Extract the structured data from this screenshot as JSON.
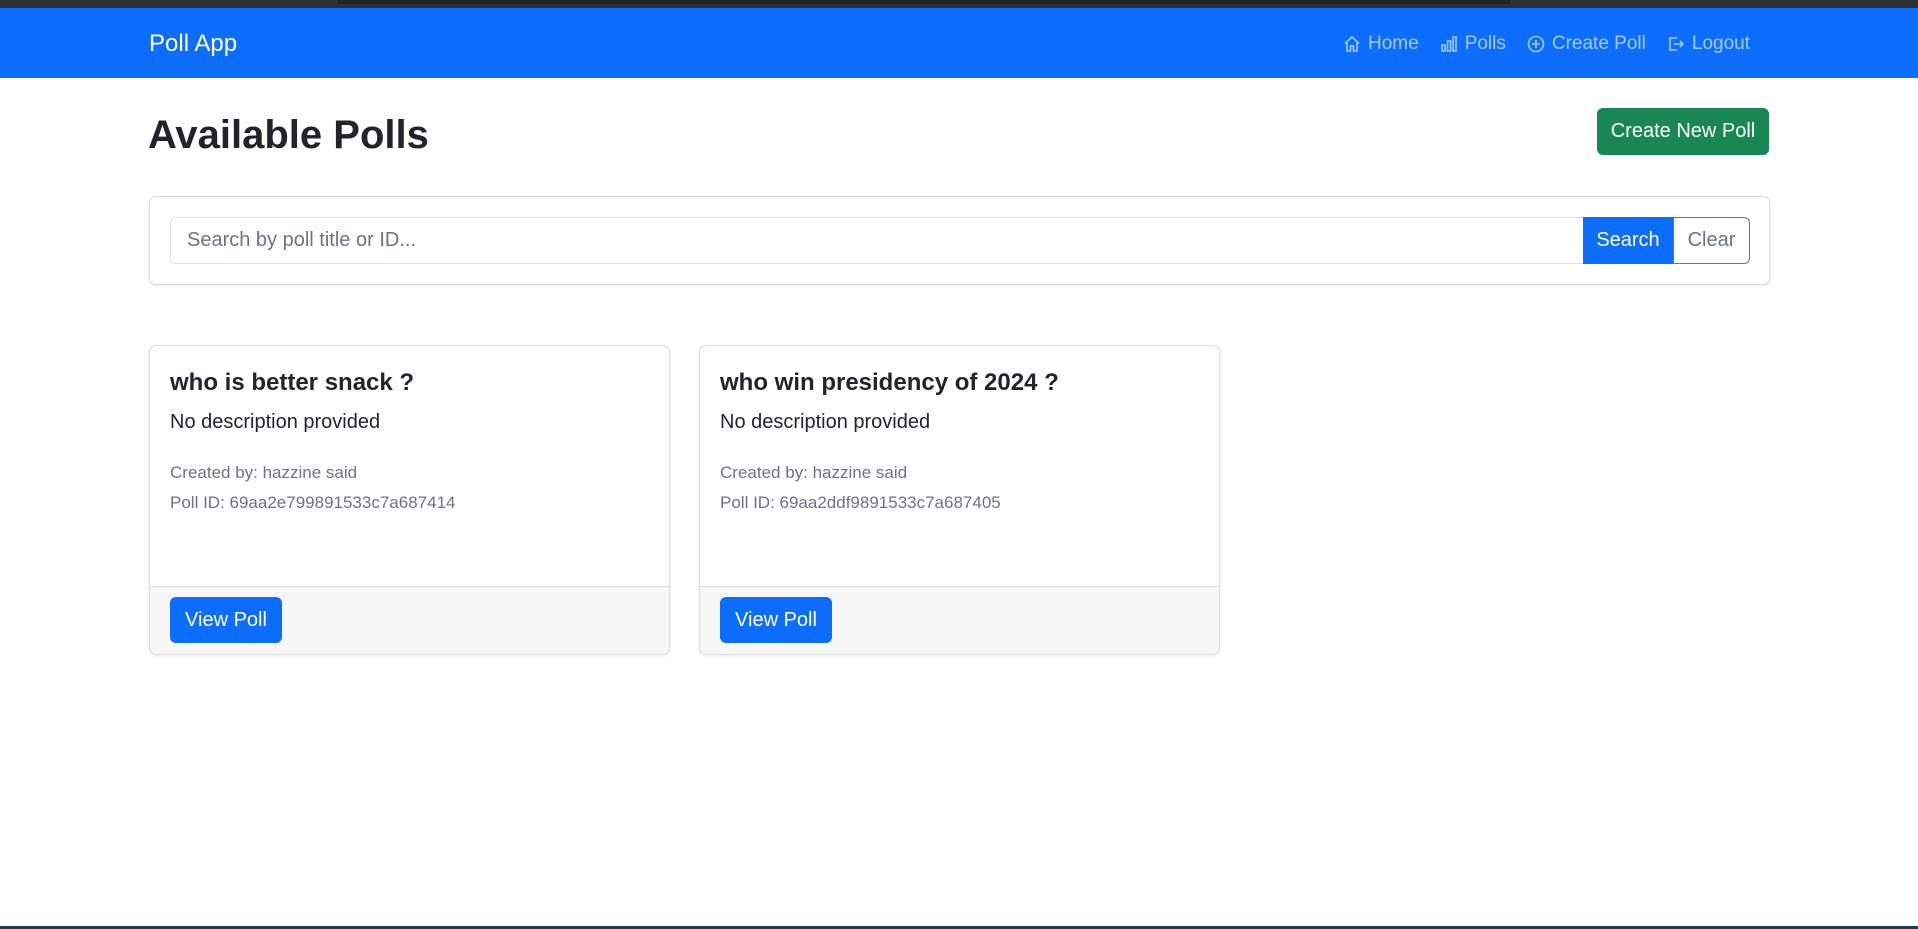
{
  "navbar": {
    "brand": "Poll App",
    "links": [
      {
        "label": "Home",
        "icon": "home-icon"
      },
      {
        "label": "Polls",
        "icon": "bar-chart-icon"
      },
      {
        "label": "Create Poll",
        "icon": "plus-circle-icon"
      },
      {
        "label": "Logout",
        "icon": "logout-icon"
      }
    ],
    "color": "#0d6efd"
  },
  "main": {
    "title": "Available Polls",
    "create_button": "Create New Poll"
  },
  "search": {
    "placeholder": "Search by poll title or ID...",
    "value": "",
    "search_button": "Search",
    "clear_button": "Clear"
  },
  "polls": [
    {
      "title": "who is better snack ?",
      "description": "No description provided",
      "created_by": "Created by: hazzine said",
      "poll_id": "Poll ID: 69aa2e799891533c7a687414",
      "view_button": "View Poll"
    },
    {
      "title": "who win presidency of 2024 ?",
      "description": "No description provided",
      "created_by": "Created by: hazzine said",
      "poll_id": "Poll ID: 69aa2ddf9891533c7a687405",
      "view_button": "View Poll"
    }
  ],
  "colors": {
    "primary": "#0d6efd",
    "success": "#198754",
    "secondary": "#6c757d"
  }
}
